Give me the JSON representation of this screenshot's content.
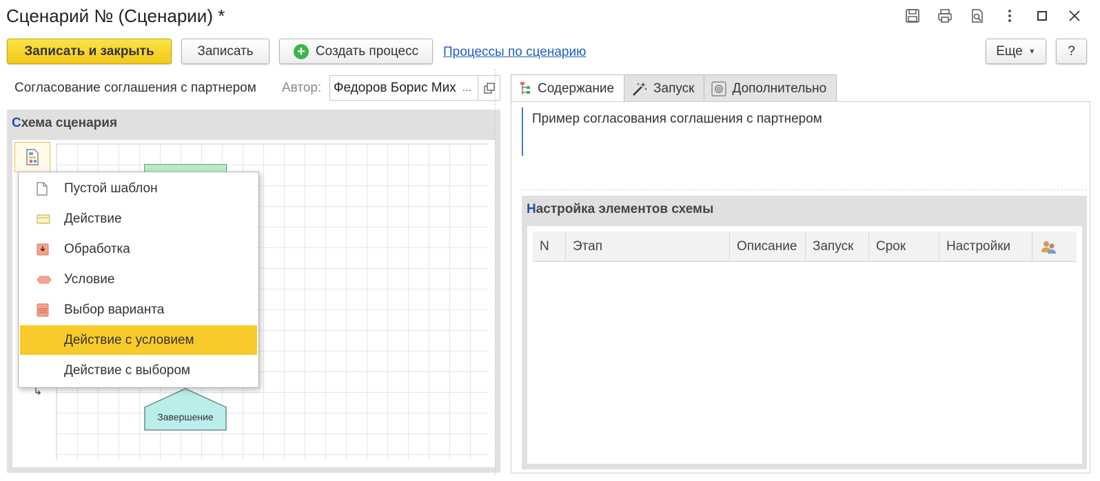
{
  "window": {
    "title": "Сценарий № (Сценарии) *",
    "icons": [
      "save-icon",
      "print-icon",
      "preview-icon",
      "more-vertical-icon",
      "maximize-icon",
      "close-icon"
    ]
  },
  "toolbar": {
    "save_close_label": "Записать и закрыть",
    "save_label": "Записать",
    "create_process_label": "Создать процесс",
    "processes_link": "Процессы по сценарию",
    "more_label": "Еще",
    "help_label": "?"
  },
  "form": {
    "scenario_name": "Согласование соглашения с партнером",
    "author_label": "Автор:",
    "author_value": "Федоров Борис Михайлович",
    "author_select": "..."
  },
  "schema": {
    "title_first": "С",
    "title_rest": "хема сценария",
    "end_node_label": "Завершение"
  },
  "menu": {
    "items": [
      {
        "label": "Пустой шаблон",
        "icon": "blank-page-icon"
      },
      {
        "label": "Действие",
        "icon": "action-icon"
      },
      {
        "label": "Обработка",
        "icon": "processing-icon"
      },
      {
        "label": "Условие",
        "icon": "condition-icon"
      },
      {
        "label": "Выбор варианта",
        "icon": "choice-icon"
      },
      {
        "label": "Действие с условием",
        "icon": "",
        "active": true
      },
      {
        "label": "Действие с выбором",
        "icon": ""
      }
    ]
  },
  "tabs": [
    {
      "label": "Содержание",
      "icon": "tree-icon",
      "active": true
    },
    {
      "label": "Запуск",
      "icon": "magic-wand-icon"
    },
    {
      "label": "Дополнительно",
      "icon": "settings-icon"
    }
  ],
  "content": {
    "description": "Пример согласования соглашения с партнером",
    "settings_title_first": "Н",
    "settings_title_rest": "астройка элементов схемы",
    "columns": [
      "N",
      "Этап",
      "Описание",
      "Запуск",
      "Срок",
      "Настройки"
    ],
    "rows": []
  },
  "colors": {
    "primary_button": "#f2c918",
    "active_menu_item": "#f8cb2a",
    "link": "#1f5ec2",
    "section_first_letter": "#2451a6"
  }
}
